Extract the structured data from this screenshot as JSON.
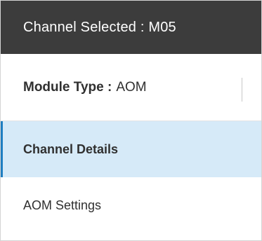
{
  "header": {
    "channel_selected": "Channel Selected : M05"
  },
  "module": {
    "label": "Module Type :",
    "value": "AOM"
  },
  "nav": {
    "items": [
      {
        "label": "Channel Details",
        "active": true
      },
      {
        "label": "AOM Settings",
        "active": false
      }
    ]
  },
  "colors": {
    "header_bg": "#3c3c3c",
    "active_bg": "#d6eaf8",
    "active_accent": "#1f7ec1"
  }
}
